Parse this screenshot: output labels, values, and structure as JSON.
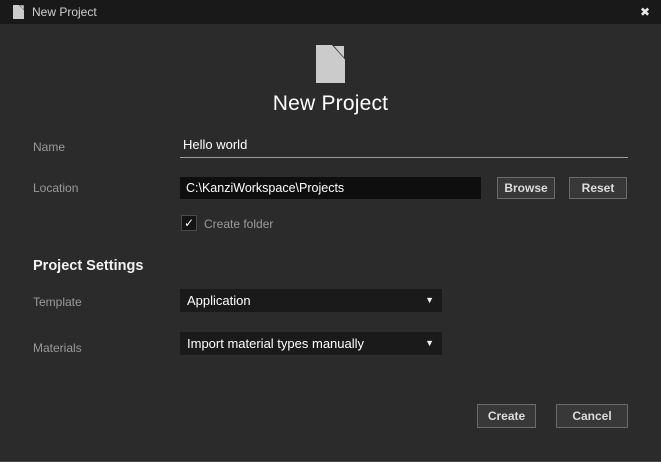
{
  "window": {
    "title": "New Project"
  },
  "icons": {
    "close": "✖",
    "dropdown_arrow": "▼",
    "checkmark": "✓"
  },
  "header": {
    "title": "New Project"
  },
  "form": {
    "name": {
      "label": "Name",
      "value": "Hello world"
    },
    "location": {
      "label": "Location",
      "value": "C:\\KanziWorkspace\\Projects"
    },
    "buttons": {
      "browse": "Browse",
      "reset": "Reset"
    },
    "create_folder": {
      "label": "Create folder",
      "checked": true
    },
    "section_title": "Project Settings",
    "template": {
      "label": "Template",
      "value": "Application"
    },
    "materials": {
      "label": "Materials",
      "value": "Import material types manually"
    }
  },
  "footer": {
    "create": "Create",
    "cancel": "Cancel"
  },
  "colors": {
    "titlebar_bg": "#191919",
    "body_bg": "#2b2b2b",
    "input_bg": "#0e0e0e",
    "dropdown_bg": "#1a1a1a",
    "button_bg": "#383838",
    "button_border": "#6b6b6b",
    "label_text": "#9a9a9a",
    "value_text": "#ffffff",
    "icon_fill": "#cbcbcb"
  }
}
